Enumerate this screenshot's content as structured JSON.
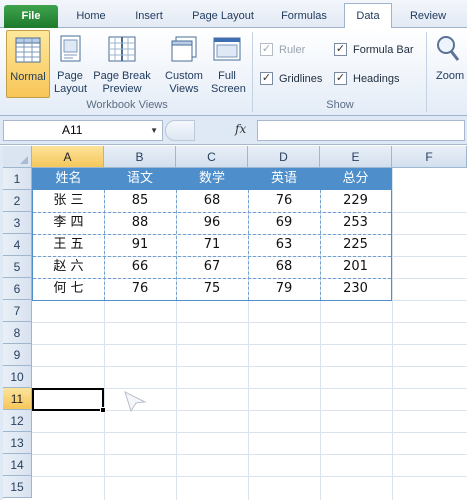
{
  "tabs": [
    "File",
    "Home",
    "Insert",
    "Page Layout",
    "Formulas",
    "Data",
    "Review"
  ],
  "ribbon": {
    "workbook_views": {
      "group_label": "Workbook Views",
      "buttons": [
        {
          "label": "Normal",
          "icon": "normal-view-icon",
          "active": true
        },
        {
          "label": "Page Layout",
          "icon": "page-layout-icon"
        },
        {
          "label": "Page Break Preview",
          "icon": "page-break-preview-icon"
        },
        {
          "label": "Custom Views",
          "icon": "custom-views-icon"
        },
        {
          "label": "Full Screen",
          "icon": "full-screen-icon"
        }
      ]
    },
    "show": {
      "group_label": "Show",
      "checkboxes": [
        {
          "label": "Ruler",
          "checked": true,
          "disabled": true
        },
        {
          "label": "Formula Bar",
          "checked": true
        },
        {
          "label": "Gridlines",
          "checked": true
        },
        {
          "label": "Headings",
          "checked": true
        }
      ]
    },
    "zoom_label": "Zoom"
  },
  "formula_bar": {
    "name_box": "A11",
    "fx_label": "fx",
    "formula": ""
  },
  "grid": {
    "columns": [
      "A",
      "B",
      "C",
      "D",
      "E",
      "F"
    ],
    "rows": [
      "1",
      "2",
      "3",
      "4",
      "5",
      "6",
      "7",
      "8",
      "9",
      "10",
      "11",
      "12",
      "13",
      "14",
      "15"
    ],
    "selected_column": "A",
    "selected_row": "11",
    "header_color": "#4e8ecb",
    "table": {
      "headers": [
        "姓名",
        "语文",
        "数学",
        "英语",
        "总分"
      ],
      "rows": [
        [
          "张 三",
          "85",
          "68",
          "76",
          "229"
        ],
        [
          "李 四",
          "88",
          "96",
          "69",
          "253"
        ],
        [
          "王 五",
          "91",
          "71",
          "63",
          "225"
        ],
        [
          "赵 六",
          "66",
          "67",
          "68",
          "201"
        ],
        [
          "何 七",
          "76",
          "75",
          "79",
          "230"
        ]
      ]
    }
  }
}
